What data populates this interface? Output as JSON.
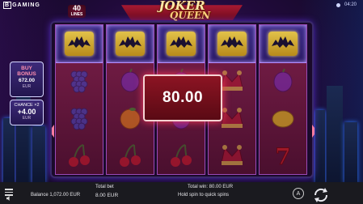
{
  "brand": {
    "name": "GAMING",
    "box_letters": "B"
  },
  "game": {
    "title_top": "JOKER",
    "title_bottom": "QUEEN"
  },
  "lines_badge": {
    "count": "40",
    "label": "LINES"
  },
  "status": {
    "time": "04:20"
  },
  "buy_bonus": {
    "title_line1": "BUY",
    "title_line2": "BONUS",
    "value": "672.00",
    "currency": "EUR"
  },
  "chance": {
    "label": "CHANCE ×2",
    "value": "+4.00",
    "currency": "EUR"
  },
  "win_popup": {
    "amount": "80.00"
  },
  "bottom_bar": {
    "balance_label": "Balance",
    "balance_value": "1,072.00 EUR",
    "total_bet_label": "Total bet",
    "total_bet_value": "8.00 EUR",
    "total_win_text": "Total win: 80.00 EUR",
    "hint_text": "Hold spin to quick spins",
    "auto_label": "A"
  },
  "reels": [
    {
      "symbols": [
        "bat-wild",
        "grape",
        "grape",
        "cherry"
      ]
    },
    {
      "symbols": [
        "bat-wild",
        "plum",
        "orange",
        "cherry"
      ]
    },
    {
      "symbols": [
        "bat-wild",
        "plum",
        "plum",
        "cherry"
      ]
    },
    {
      "symbols": [
        "bat-wild",
        "jester-hat",
        "jester-hat",
        "jester-hat"
      ]
    },
    {
      "symbols": [
        "bat-wild",
        "plum",
        "lemon",
        "seven"
      ]
    }
  ],
  "colors": {
    "accent": "#c0183a",
    "popup_border": "#f6d3d3",
    "reel_bg": "#7c1f4a",
    "wild_bg": "#3c2c8a"
  }
}
